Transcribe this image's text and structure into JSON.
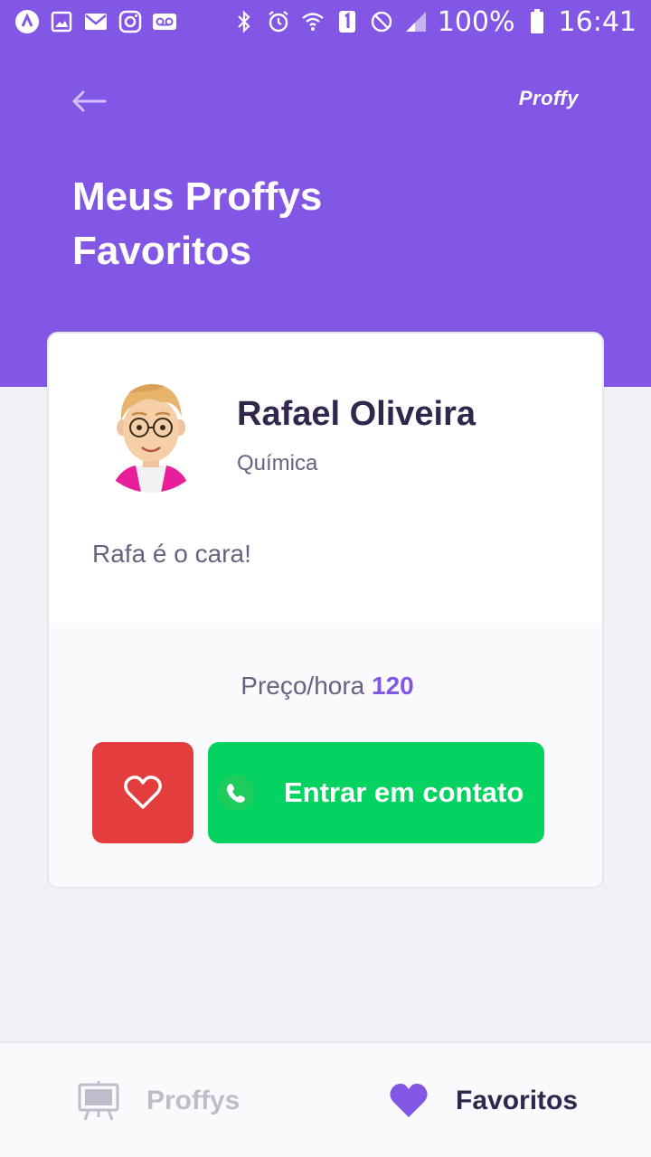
{
  "status_bar": {
    "battery": "100%",
    "time": "16:41",
    "left_icons": [
      "assistant-icon",
      "image-icon",
      "mail-icon",
      "instagram-icon",
      "voicemail-icon"
    ],
    "right_icons": [
      "bluetooth-icon",
      "alarm-icon",
      "wifi-icon",
      "sim-icon",
      "do-not-disturb-icon",
      "signal-icon",
      "battery-icon"
    ]
  },
  "header": {
    "logo": "Proffy",
    "title": "Meus Proffys Favoritos"
  },
  "card": {
    "name": "Rafael Oliveira",
    "subject": "Química",
    "bio": "Rafa é o cara!",
    "price_label": "Preço/hora",
    "price_value": "120",
    "contact_label": "Entrar em contato"
  },
  "tabs": [
    {
      "label": "Proffys",
      "icon": "easel-icon",
      "active": false
    },
    {
      "label": "Favoritos",
      "icon": "heart-icon",
      "active": true
    }
  ],
  "colors": {
    "primary": "#8257E5",
    "favorite_button": "#E33D3D",
    "contact_button": "#04D361",
    "title_text": "#32264D",
    "body_text": "#6A6180",
    "inactive_tab": "#C1BCCC"
  }
}
